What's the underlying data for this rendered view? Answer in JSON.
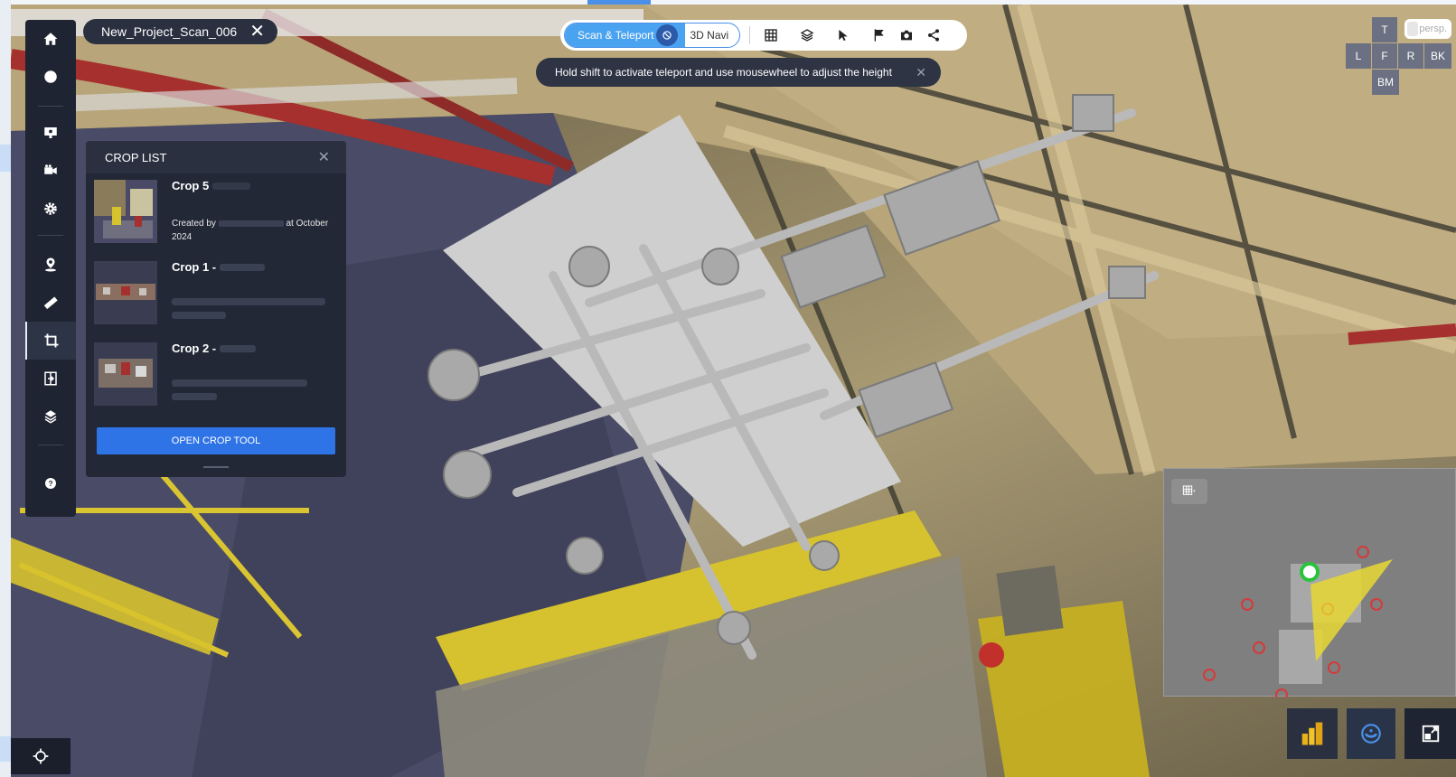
{
  "project": {
    "name": "New_Project_Scan_006"
  },
  "navbar": {
    "mode_active": "Scan & Teleport",
    "mode_inactive": "3D Navi",
    "icons": [
      "grid-icon",
      "layers-icon",
      "pointer-icon",
      "flag-icon",
      "camera-icon",
      "share-icon"
    ]
  },
  "hint": {
    "text": "Hold shift to activate teleport and use mousewheel to adjust the height"
  },
  "view_cube": {
    "top": "T",
    "left": "L",
    "front": "F",
    "right": "R",
    "back": "BK",
    "bottom": "BM",
    "projection": "persp."
  },
  "toolbar": {
    "icons": [
      "home-icon",
      "circle-icon",
      "presentation-icon",
      "video-camera-icon",
      "gear-icon",
      "location-icon",
      "ruler-icon",
      "crop-icon",
      "compare-icon",
      "model-icon",
      "help-icon"
    ],
    "active": "crop-icon"
  },
  "crop_list": {
    "title": "CROP LIST",
    "items": [
      {
        "title": "Crop 5 - ",
        "meta_prefix": "Created by ",
        "meta_suffix": " at October 2024"
      },
      {
        "title": "Crop 1 - "
      },
      {
        "title": "Crop 2 - "
      }
    ],
    "open_button": "OPEN CROP TOOL"
  },
  "colors": {
    "accent": "#2f74e6",
    "panel": "#222836",
    "mode_active": "#4aa3f0"
  }
}
